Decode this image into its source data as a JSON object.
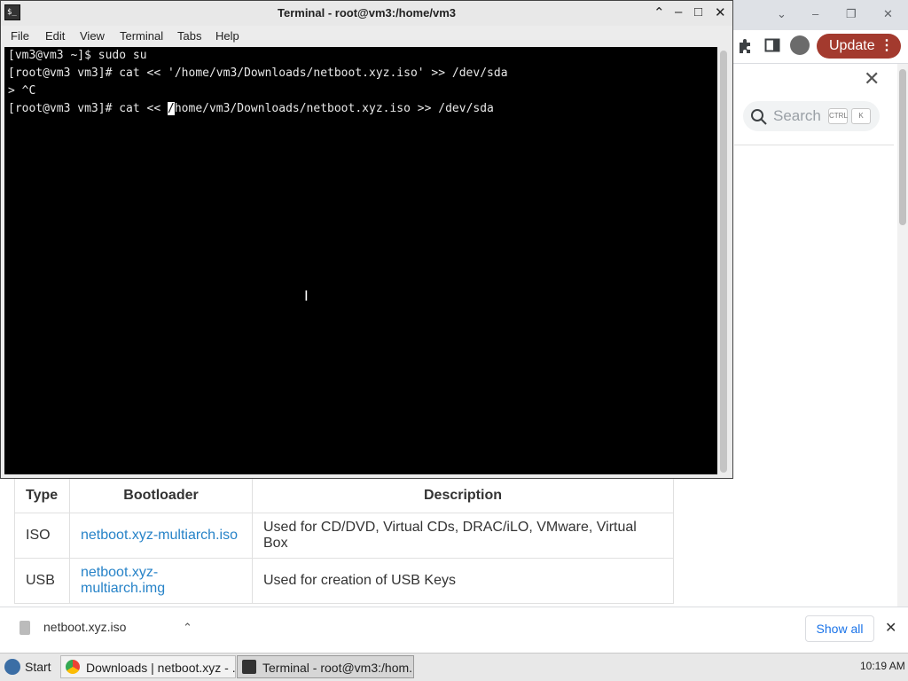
{
  "terminal": {
    "title": "Terminal - root@vm3:/home/vm3",
    "menu": [
      "File",
      "Edit",
      "View",
      "Terminal",
      "Tabs",
      "Help"
    ],
    "lines": [
      "[vm3@vm3 ~]$ sudo su",
      "[root@vm3 vm3]# cat << '/home/vm3/Downloads/netboot.xyz.iso' >> /dev/sda",
      "> ^C"
    ],
    "current_prompt": "[root@vm3 vm3]# cat << ",
    "cursor_char": "/",
    "current_rest": "home/vm3/Downloads/netboot.xyz.iso >> /dev/sda"
  },
  "browser": {
    "update_label": "Update",
    "search_placeholder": "Search",
    "kbd_ctrl": "CTRL",
    "kbd_k": "K",
    "table": {
      "headers": [
        "Type",
        "Bootloader",
        "Description"
      ],
      "rows": [
        {
          "type": "ISO",
          "bootloader": "netboot.xyz-multiarch.iso",
          "description": "Used for CD/DVD, Virtual CDs, DRAC/iLO, VMware, Virtual Box"
        },
        {
          "type": "USB",
          "bootloader": "netboot.xyz-multiarch.img",
          "description": "Used for creation of USB Keys"
        }
      ]
    }
  },
  "downloads": {
    "file_name": "netboot.xyz.iso",
    "show_all": "Show all"
  },
  "taskbar": {
    "start_label": "Start",
    "tasks": [
      "Downloads | netboot.xyz - ...",
      "Terminal - root@vm3:/hom..."
    ],
    "clock": "10:19 AM"
  }
}
